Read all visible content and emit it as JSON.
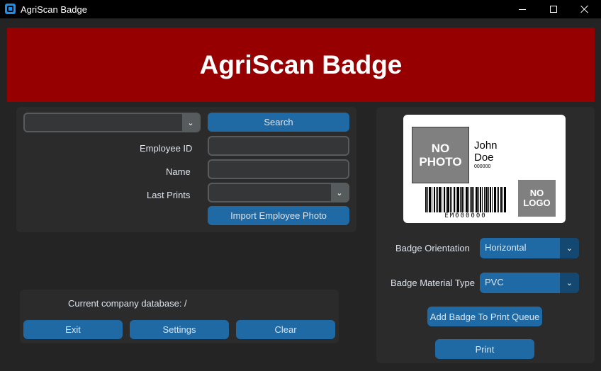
{
  "window": {
    "title": "AgriScan Badge"
  },
  "header": {
    "title": "AgriScan Badge",
    "background": "#960000"
  },
  "search": {
    "combo_value": "",
    "search_label": "Search",
    "employee_id_label": "Employee ID",
    "employee_id_value": "",
    "name_label": "Name",
    "name_value": "",
    "last_prints_label": "Last Prints",
    "last_prints_value": "",
    "import_photo_label": "Import Employee Photo"
  },
  "footer": {
    "database_label": "Current company database: /",
    "exit_label": "Exit",
    "settings_label": "Settings",
    "clear_label": "Clear"
  },
  "badge_preview": {
    "photo_line1": "NO",
    "photo_line2": "PHOTO",
    "first_name": "John",
    "last_name": "Doe",
    "employee_number": "000000",
    "logo_line1": "NO",
    "logo_line2": "LOGO",
    "barcode_text": "EM000000"
  },
  "options": {
    "orientation_label": "Badge Orientation",
    "orientation_value": "Horizontal",
    "material_label": "Badge Material Type",
    "material_value": "PVC",
    "add_queue_label": "Add Badge To Print Queue",
    "print_label": "Print"
  },
  "colors": {
    "accent": "#1f6aa5",
    "accent_dark": "#144870",
    "panel": "#2b2b2b",
    "background": "#242424"
  },
  "icons": {
    "dropdown": "chevron-down-icon",
    "app": "app-icon"
  }
}
